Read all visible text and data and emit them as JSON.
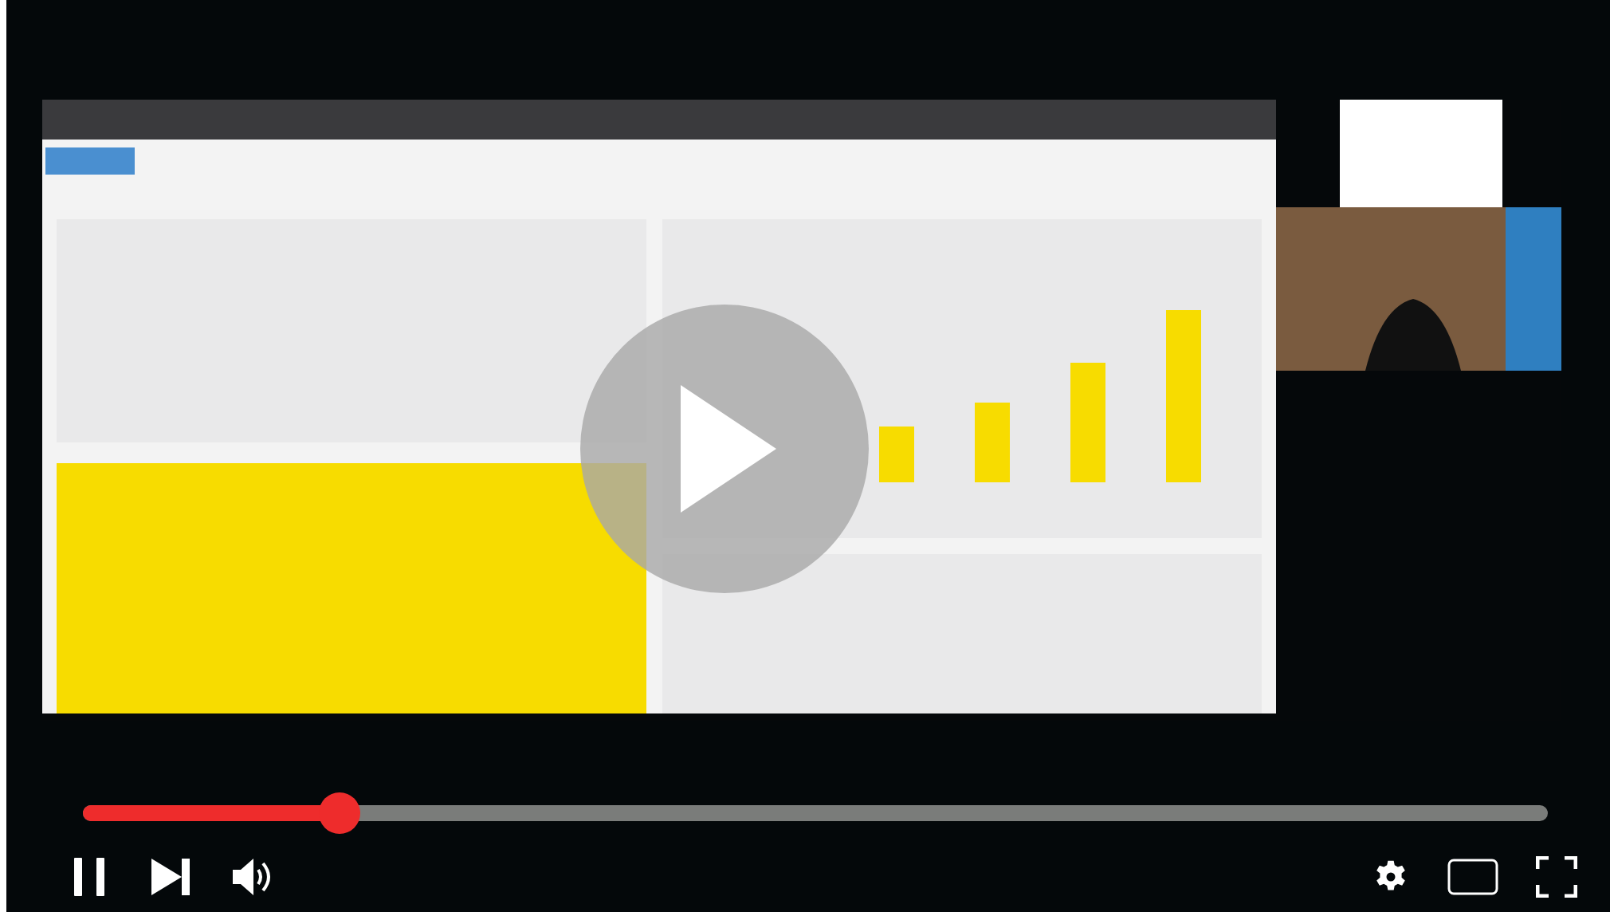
{
  "player": {
    "playing": true,
    "overlay_play_button": true,
    "progress": {
      "level": 0.175
    }
  }
}
